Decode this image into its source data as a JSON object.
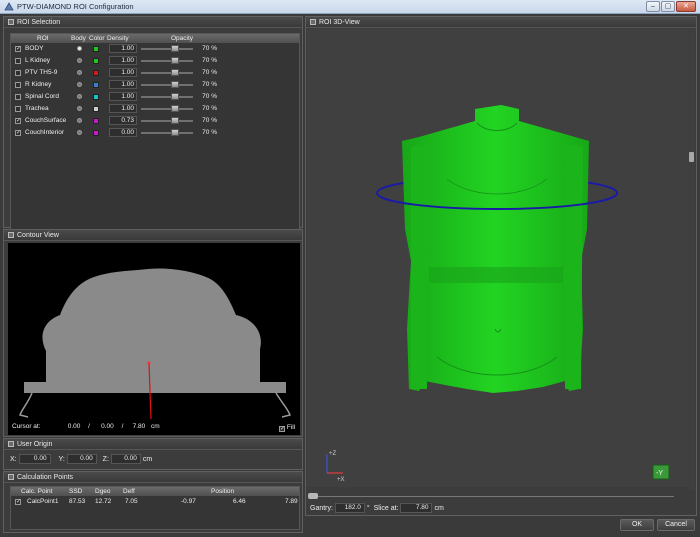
{
  "window": {
    "title": "PTW-DIAMOND ROI Configuration",
    "min_glyph": "–",
    "max_glyph": "▢",
    "close_glyph": "✕"
  },
  "roi_selection": {
    "title": "ROI Selection",
    "columns": {
      "roi": "ROI",
      "body": "Body",
      "color": "Color",
      "density": "Density",
      "opacity": "Opacity"
    },
    "rows": [
      {
        "checked": true,
        "check_glyph": "✓",
        "name": "BODY",
        "body": true,
        "color": "#1ec81e",
        "density": "1.00",
        "opacity": "70 %"
      },
      {
        "checked": false,
        "check_glyph": "",
        "name": "L Kidney",
        "body": false,
        "color": "#1ec81e",
        "density": "1.00",
        "opacity": "70 %"
      },
      {
        "checked": false,
        "check_glyph": "",
        "name": "PTV TH5-9",
        "body": false,
        "color": "#d41a1a",
        "density": "1.00",
        "opacity": "70 %"
      },
      {
        "checked": false,
        "check_glyph": "",
        "name": "R Kidney",
        "body": false,
        "color": "#3a7fd6",
        "density": "1.00",
        "opacity": "70 %"
      },
      {
        "checked": false,
        "check_glyph": "",
        "name": "Spinal Cord",
        "body": false,
        "color": "#19c5c5",
        "density": "1.00",
        "opacity": "70 %"
      },
      {
        "checked": false,
        "check_glyph": "",
        "name": "Trachea",
        "body": false,
        "color": "#cfcfcf",
        "density": "1.00",
        "opacity": "70 %"
      },
      {
        "checked": true,
        "check_glyph": "✓",
        "name": "CouchSurface",
        "body": false,
        "color": "#c819c8",
        "density": "0.73",
        "opacity": "70 %"
      },
      {
        "checked": true,
        "check_glyph": "✓",
        "name": "CouchInterior",
        "body": false,
        "color": "#c819c8",
        "density": "0.00",
        "opacity": "70 %"
      }
    ]
  },
  "contour_view": {
    "title": "Contour View",
    "cursor_label": "Cursor at:",
    "x": "0.00",
    "sep1": "/",
    "y": "0.00",
    "sep2": "/",
    "z": "7.80",
    "unit": "cm",
    "fill_label": "Fill",
    "fill_checked": true,
    "fill_glyph": "✓"
  },
  "user_origin": {
    "title": "User Origin",
    "x_label": "X:",
    "x": "0.00",
    "y_label": "Y:",
    "y": "0.00",
    "z_label": "Z:",
    "z": "0.00",
    "unit": "cm"
  },
  "calc_points": {
    "title": "Calculation Points",
    "columns": [
      "Calc. Point",
      "SSD",
      "Dgeo",
      "Deff",
      "Position"
    ],
    "rows": [
      {
        "checked": true,
        "check_glyph": "✓",
        "name": "CalcPoint1",
        "ssd": "87.53",
        "dgeo": "12.72",
        "deff": "7.05",
        "pos_x": "-0.97",
        "pos_y": "6.46",
        "pos_z": "7.89"
      }
    ]
  },
  "view3d": {
    "title": "ROI 3D-View",
    "axis_z": "+Z",
    "axis_x": "+X",
    "orient_label": "-Y",
    "gantry_label": "Gantry:",
    "gantry_value": "182.0",
    "gantry_unit": "°",
    "slice_label": "Slice at:",
    "slice_value": "7.80",
    "slice_unit": "cm",
    "body_color": "#1fc81f",
    "ring_color": "#1a1aa8"
  },
  "buttons": {
    "ok": "OK",
    "cancel": "Cancel"
  }
}
